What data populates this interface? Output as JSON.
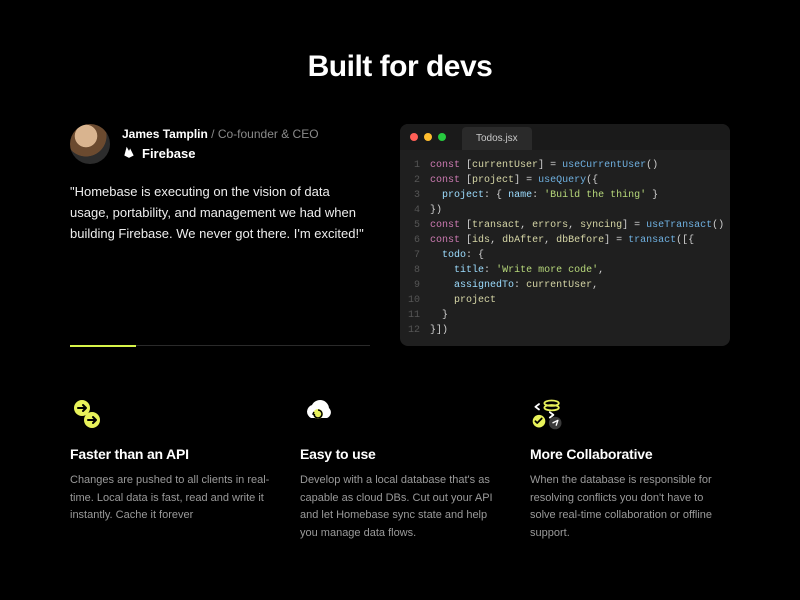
{
  "title": "Built for devs",
  "testimonial": {
    "name": "James Tamplin",
    "sep": " / ",
    "role": "Co-founder & CEO",
    "company": "Firebase",
    "quote": "\"Homebase is executing on the vision of data usage, portability, and management we had when building Firebase. We never got there. I'm excited!\""
  },
  "code": {
    "filename": "Todos.jsx",
    "lines": [
      [
        [
          "kw",
          "const"
        ],
        [
          "punc",
          " ["
        ],
        [
          "id",
          "currentUser"
        ],
        [
          "punc",
          "] = "
        ],
        [
          "fn",
          "useCurrentUser"
        ],
        [
          "punc",
          "()"
        ]
      ],
      [
        [
          "kw",
          "const"
        ],
        [
          "punc",
          " ["
        ],
        [
          "id",
          "project"
        ],
        [
          "punc",
          "] = "
        ],
        [
          "fn",
          "useQuery"
        ],
        [
          "punc",
          "({"
        ]
      ],
      [
        [
          "punc",
          "  "
        ],
        [
          "key",
          "project"
        ],
        [
          "punc",
          ": { "
        ],
        [
          "key",
          "name"
        ],
        [
          "punc",
          ": "
        ],
        [
          "str",
          "'Build the thing'"
        ],
        [
          "punc",
          " }"
        ]
      ],
      [
        [
          "punc",
          "})"
        ]
      ],
      [
        [
          "kw",
          "const"
        ],
        [
          "punc",
          " ["
        ],
        [
          "id",
          "transact"
        ],
        [
          "punc",
          ", "
        ],
        [
          "id",
          "errors"
        ],
        [
          "punc",
          ", "
        ],
        [
          "id",
          "syncing"
        ],
        [
          "punc",
          "] = "
        ],
        [
          "fn",
          "useTransact"
        ],
        [
          "punc",
          "()"
        ]
      ],
      [
        [
          "kw",
          "const"
        ],
        [
          "punc",
          " ["
        ],
        [
          "id",
          "ids"
        ],
        [
          "punc",
          ", "
        ],
        [
          "id",
          "dbAfter"
        ],
        [
          "punc",
          ", "
        ],
        [
          "id",
          "dbBefore"
        ],
        [
          "punc",
          "] = "
        ],
        [
          "fn",
          "transact"
        ],
        [
          "punc",
          "([{"
        ]
      ],
      [
        [
          "punc",
          "  "
        ],
        [
          "key",
          "todo"
        ],
        [
          "punc",
          ": {"
        ]
      ],
      [
        [
          "punc",
          "    "
        ],
        [
          "key",
          "title"
        ],
        [
          "punc",
          ": "
        ],
        [
          "str",
          "'Write more code'"
        ],
        [
          "punc",
          ","
        ]
      ],
      [
        [
          "punc",
          "    "
        ],
        [
          "key",
          "assignedTo"
        ],
        [
          "punc",
          ": "
        ],
        [
          "id",
          "currentUser"
        ],
        [
          "punc",
          ","
        ]
      ],
      [
        [
          "punc",
          "    "
        ],
        [
          "id",
          "project"
        ]
      ],
      [
        [
          "punc",
          "  }"
        ]
      ],
      [
        [
          "punc",
          "}])"
        ]
      ]
    ]
  },
  "features": [
    {
      "icon": "arrows-icon",
      "title": "Faster than an API",
      "body": "Changes are pushed to all clients in real-time. Local data is fast, read and write it instantly. Cache it forever"
    },
    {
      "icon": "cloud-sync-icon",
      "title": "Easy to use",
      "body": "Develop with a local database that's as capable as cloud DBs. Cut out your API and let Homebase sync state and help you manage data flows."
    },
    {
      "icon": "collab-icon",
      "title": "More Collaborative",
      "body": "When the database is responsible for resolving conflicts you don't have to solve real-time collaboration or offline support."
    }
  ]
}
